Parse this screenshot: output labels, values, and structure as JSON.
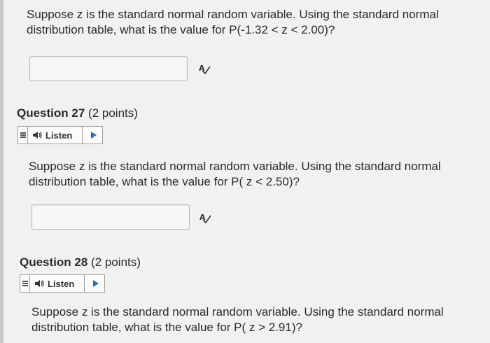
{
  "questions": [
    {
      "text_line1": "Suppose z is the standard normal random variable. Using the standard normal",
      "text_line2": "distribution table, what is the value for P(-1.32 < z < 2.00)?"
    },
    {
      "number_label": "Question 27",
      "points": "(2 points)",
      "listen_label": "Listen",
      "text_line1": "Suppose z is the standard normal random variable. Using the standard normal",
      "text_line2": "distribution table, what is the value for P( z < 2.50)?"
    },
    {
      "number_label": "Question 28",
      "points": "(2 points)",
      "listen_label": "Listen",
      "text_line1": "Suppose z is the standard normal random variable. Using the standard normal",
      "text_line2": "distribution table, what is the value for P( z > 2.91)?"
    }
  ],
  "icons": {
    "spell_check": "spell-check-icon",
    "listen_menu": "menu-icon",
    "speaker": "speaker-icon",
    "play": "play-icon"
  },
  "colors": {
    "background": "#f1f1ef",
    "play_accent": "#2f6fb3"
  }
}
